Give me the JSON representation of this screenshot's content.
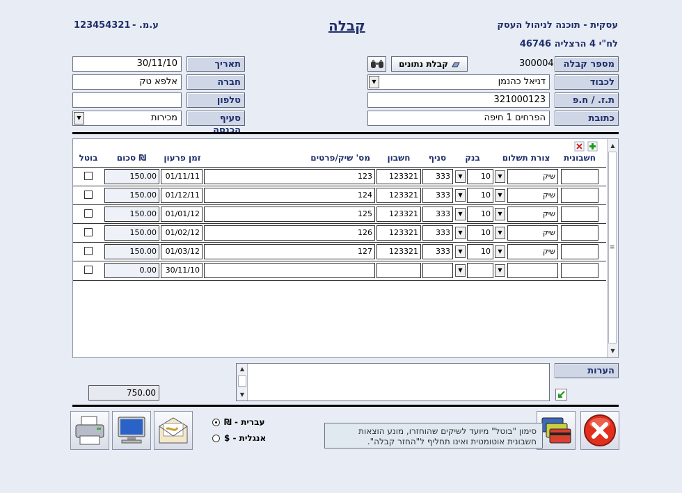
{
  "header": {
    "company_line": "עסקית - תוכנה לניהול העסק",
    "address_line": "לח\"י 4 הרצליה 46746",
    "title": "קבלה",
    "business_id_label": "ע.מ. -",
    "business_id": "123454321"
  },
  "form_left": {
    "date_label": "תאריך",
    "date_value": "30/11/10",
    "company_label": "חברה",
    "company_value": "אלפא טק",
    "phone_label": "טלפון",
    "phone_value": "",
    "income_label": "סעיף הכנסה",
    "income_value": "מכירות"
  },
  "form_right": {
    "receipt_no_label": "מספר קבלה",
    "receipt_no_value": "300004",
    "receive_data_button": "קבלת נתונים",
    "to_label": "לכבוד",
    "to_value": "דניאל כהנמן",
    "id_label": "ת.ז. / ח.פ",
    "id_value": "321000123",
    "address_label": "כתובת",
    "address_value": "הפרחים 1 חיפה"
  },
  "table": {
    "headers": {
      "invoice": "חשבונית",
      "payment_type": "צורת תשלום",
      "bank": "בנק",
      "branch": "סניף",
      "account": "חשבון",
      "check_no": "מס' שיק/פרטים",
      "due_date": "זמן פרעון",
      "amount": "סכום ₪",
      "cancel": "בוטל"
    },
    "rows": [
      {
        "invoice": "",
        "payment_type": "שיק",
        "bank": "10",
        "branch": "333",
        "account": "123321",
        "check_no": "123",
        "due_date": "01/11/11",
        "amount": "150.00"
      },
      {
        "invoice": "",
        "payment_type": "שיק",
        "bank": "10",
        "branch": "333",
        "account": "123321",
        "check_no": "124",
        "due_date": "01/12/11",
        "amount": "150.00"
      },
      {
        "invoice": "",
        "payment_type": "שיק",
        "bank": "10",
        "branch": "333",
        "account": "123321",
        "check_no": "125",
        "due_date": "01/01/12",
        "amount": "150.00"
      },
      {
        "invoice": "",
        "payment_type": "שיק",
        "bank": "10",
        "branch": "333",
        "account": "123321",
        "check_no": "126",
        "due_date": "01/02/12",
        "amount": "150.00"
      },
      {
        "invoice": "",
        "payment_type": "שיק",
        "bank": "10",
        "branch": "333",
        "account": "123321",
        "check_no": "127",
        "due_date": "01/03/12",
        "amount": "150.00"
      },
      {
        "invoice": "",
        "payment_type": "",
        "bank": "",
        "branch": "",
        "account": "",
        "check_no": "",
        "due_date": "30/11/10",
        "amount": "0.00"
      }
    ]
  },
  "notes_label": "הערות",
  "notes_value": "",
  "total": "750.00",
  "info_note": "סימון \"בוטל\" מיועד לשיקים שהוחזרו, מונע הוצאות חשבונית אוטומטית ואינו תחליף ל\"החזר קבלה\".",
  "language": {
    "hebrew": "עברית - ₪",
    "english": "אנגלית - $",
    "selected": "hebrew"
  },
  "colors": {
    "background": "#e8ecf4",
    "label_bg": "#cfd6e6",
    "text_blue": "#1f2f6b"
  }
}
